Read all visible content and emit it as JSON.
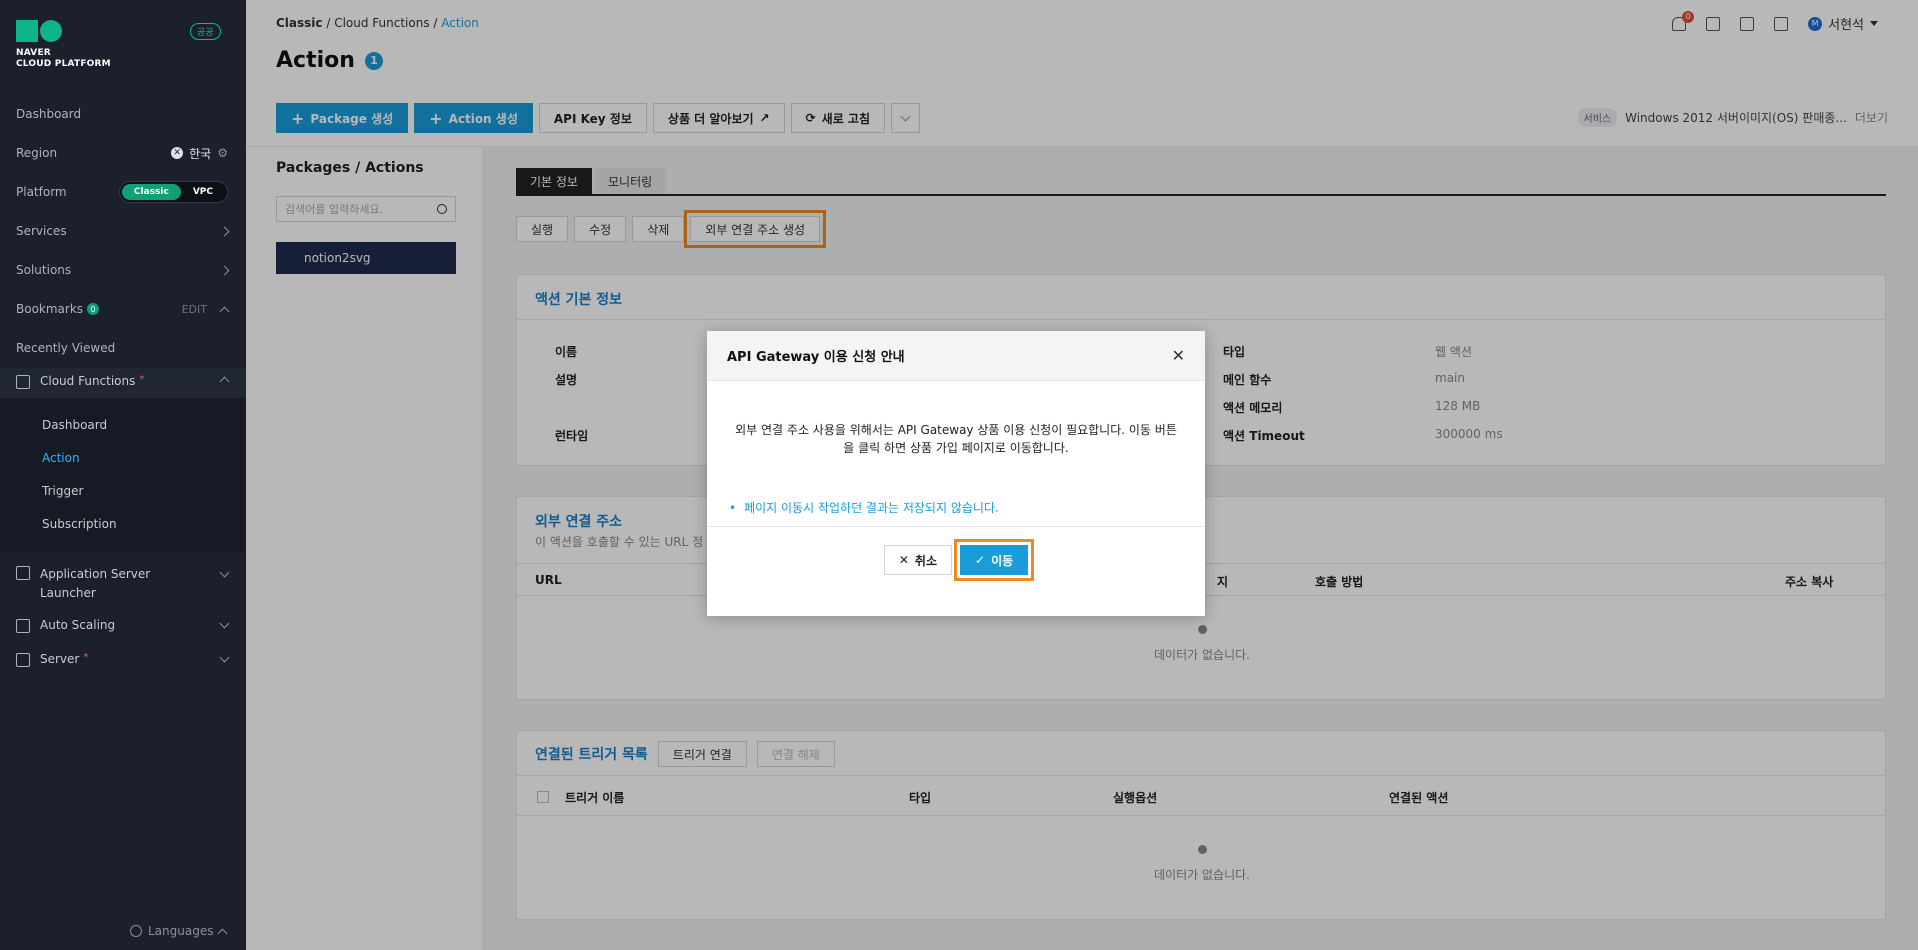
{
  "sidebar": {
    "logo_line1": "NAVER",
    "logo_line2": "CLOUD PLATFORM",
    "badge": "공공",
    "dashboard": "Dashboard",
    "region_label": "Region",
    "region_value": "한국",
    "platform_label": "Platform",
    "platform_opt1": "Classic",
    "platform_opt2": "VPC",
    "services": "Services",
    "solutions": "Solutions",
    "bookmarks": "Bookmarks",
    "bookmarks_count": "0",
    "bookmarks_edit": "EDIT",
    "recently_viewed": "Recently Viewed",
    "cloud_functions": "Cloud Functions",
    "cf_sub": [
      "Dashboard",
      "Action",
      "Trigger",
      "Subscription"
    ],
    "app_server": "Application Server",
    "app_server2": "Launcher",
    "auto_scaling": "Auto Scaling",
    "server": "Server",
    "languages": "Languages"
  },
  "header": {
    "crumb1": "Classic",
    "crumb2": "Cloud Functions",
    "crumb3": "Action",
    "title": "Action",
    "count": "1",
    "notif": "0",
    "user": "서현석",
    "user_initial": "M"
  },
  "toolbar": {
    "pkg_create": "Package 생성",
    "action_create": "Action 생성",
    "api_key": "API Key 정보",
    "learn_more": "상품 더 알아보기",
    "refresh": "새로 고침",
    "svc_tag": "서비스",
    "svc_text": "Windows 2012 서버이미지(OS) 판매종...",
    "svc_more": "더보기"
  },
  "left": {
    "title": "Packages / Actions",
    "search_placeholder": "검색어를 입력하세요.",
    "item": "notion2svg"
  },
  "tabs": [
    "기본 정보",
    "모니터링"
  ],
  "actions": [
    "실행",
    "수정",
    "삭제",
    "외부 연결 주소 생성"
  ],
  "info": {
    "title": "액션 기본 정보",
    "name_k": "이름",
    "desc_k": "설명",
    "runtime_k": "런타임",
    "type_k": "타입",
    "type_v": "웹 액션",
    "main_k": "메인 함수",
    "main_v": "main",
    "mem_k": "액션 메모리",
    "mem_v": "128 MB",
    "timeout_k": "액션 Timeout",
    "timeout_v": "300000 ms"
  },
  "ext": {
    "title": "외부 연결 주소",
    "subtitle": "이 액션을 호출할 수 있는 URL 정",
    "col_url": "URL",
    "col_ji": "지",
    "col_method": "호출 방법",
    "col_copy": "주소 복사",
    "empty": "데이터가 없습니다."
  },
  "trig": {
    "title": "연결된 트리거 목록",
    "connect": "트리거 연결",
    "disconnect": "연결 해제",
    "col_name": "트리거 이름",
    "col_type": "타입",
    "col_opt": "실행옵션",
    "col_action": "연결된 액션",
    "empty": "데이터가 없습니다."
  },
  "modal": {
    "title": "API Gateway 이용 신청 안내",
    "body1": "외부 연결 주소 사용을 위해서는 API Gateway 상품 이용 신청이 필요합니다. 이동 버튼",
    "body2": "을 클릭 하면 상품 가입 페이지로 이동합니다.",
    "note": "페이지 이동시 작업하던 결과는 저장되지 않습니다.",
    "cancel": "취소",
    "go": "이동"
  }
}
